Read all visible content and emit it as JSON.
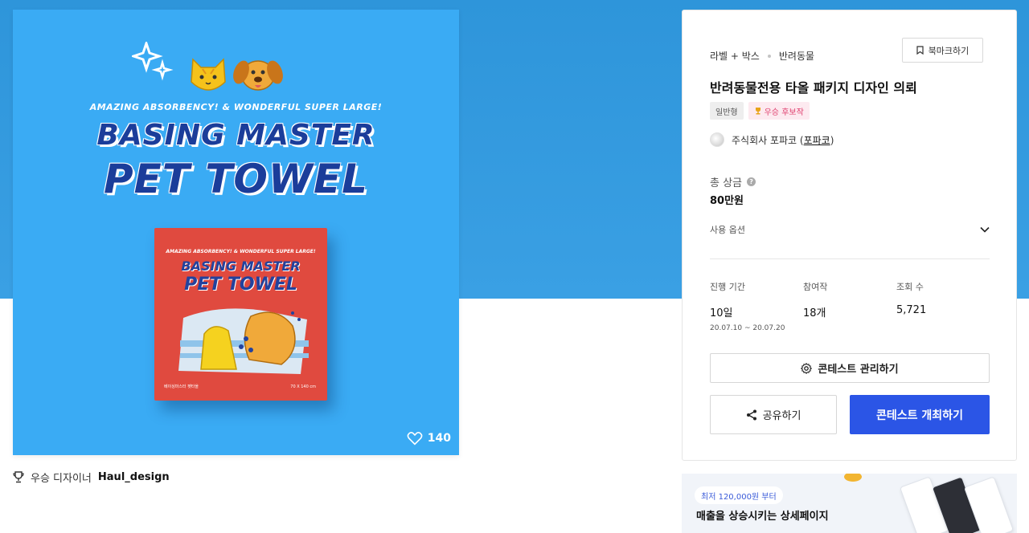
{
  "artwork": {
    "tagline": "AMAZING ABSORBENCY! & WONDERFUL SUPER LARGE!",
    "title_line1": "BASING MASTER",
    "title_line2": "PET TOWEL",
    "box_tagline": "AMAZING ABSORBENCY! & WONDERFUL SUPER LARGE!",
    "box_line1": "BASING MASTER",
    "box_line2": "PET TOWEL",
    "box_footer_left": "베이싱마스터 펫타올",
    "box_footer_right": "70 X 140 cm",
    "likes": "140",
    "colors": {
      "background": "#3aabf4",
      "box": "#e04a3f",
      "title": "#1b3d9a"
    }
  },
  "caption": {
    "prefix": "우승 디자이너",
    "designer": "Haul_design"
  },
  "panel": {
    "breadcrumb": [
      "라벨 + 박스",
      "반려동물"
    ],
    "bookmark_label": "북마크하기",
    "title": "반려동물전용 타올 패키지 디자인 의뢰",
    "tags": [
      "일반형",
      "우승 후보작"
    ],
    "company_prefix": "주식회사 포파코 (",
    "company_link": "포파코",
    "company_suffix": ")",
    "prize_label": "총 상금",
    "prize_value": "80만원",
    "usage_option_label": "사용 옵션",
    "stats": {
      "period_label": "진행 기간",
      "period_value": "10일",
      "period_range": "20.07.10 ~ 20.07.20",
      "entries_label": "참여작",
      "entries_value": "18개",
      "views_label": "조회 수",
      "views_value": "5,721"
    },
    "manage_label": "콘테스트 관리하기",
    "share_label": "공유하기",
    "host_label": "콘테스트 개최하기",
    "accent_color": "#2b55e6"
  },
  "banner": {
    "pill": "최저 120,000원 부터",
    "headline": "매출을 상승시키는 상세페이지"
  }
}
